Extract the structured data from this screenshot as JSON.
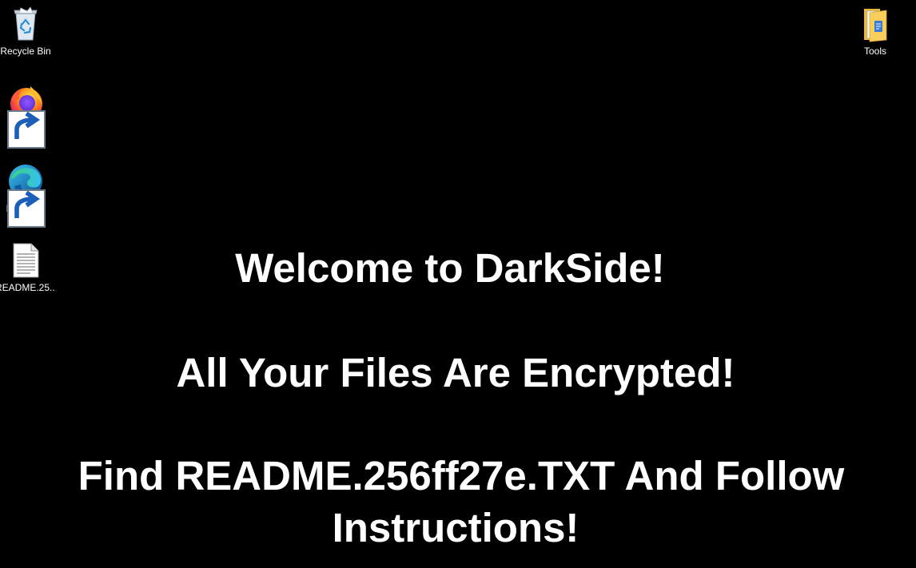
{
  "desktop": {
    "background_color": "#000000",
    "icons": [
      {
        "label": "Recycle Bin",
        "icon": "recycle-bin-icon"
      },
      {
        "label": "Firefox",
        "icon": "firefox-icon",
        "shortcut": true
      },
      {
        "label": "Microsoft Edge",
        "icon": "edge-icon",
        "shortcut": true
      },
      {
        "label": "README.25...",
        "icon": "text-file-icon"
      },
      {
        "label": "Tools",
        "icon": "folder-icon"
      }
    ]
  },
  "ransom_message": {
    "line1": "Welcome to DarkSide!",
    "line2": "All Your Files Are Encrypted!",
    "line3": "Find README.256ff27e.TXT And Follow",
    "line4": "Instructions!",
    "text_color": "#ffffff"
  }
}
